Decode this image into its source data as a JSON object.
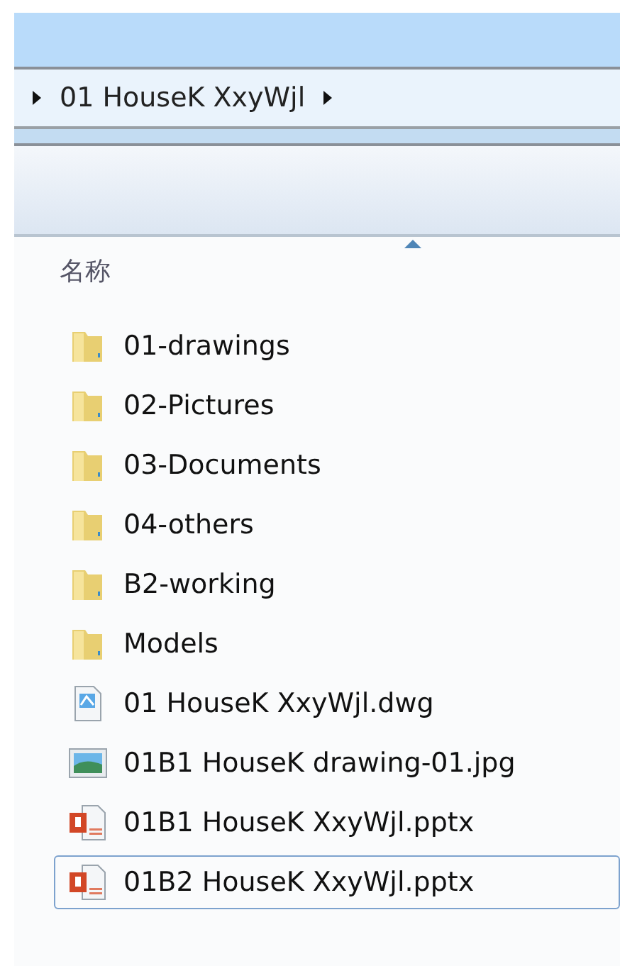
{
  "breadcrumb": {
    "items": [
      "01 HouseK XxyWjl"
    ]
  },
  "column_header": {
    "label": "名称",
    "sorted": true
  },
  "files": [
    {
      "kind": "folder",
      "name": "01-drawings",
      "focused": false
    },
    {
      "kind": "folder",
      "name": "02-Pictures",
      "focused": false
    },
    {
      "kind": "folder",
      "name": "03-Documents",
      "focused": false
    },
    {
      "kind": "folder",
      "name": "04-others",
      "focused": false
    },
    {
      "kind": "folder",
      "name": "B2-working",
      "focused": false
    },
    {
      "kind": "folder",
      "name": "Models",
      "focused": false
    },
    {
      "kind": "dwg",
      "name": "01 HouseK XxyWjl.dwg",
      "focused": false
    },
    {
      "kind": "image",
      "name": "01B1 HouseK drawing-01.jpg",
      "focused": false
    },
    {
      "kind": "pptx",
      "name": "01B1 HouseK XxyWjl.pptx",
      "focused": false
    },
    {
      "kind": "pptx",
      "name": "01B2 HouseK XxyWjl.pptx",
      "focused": true
    }
  ]
}
